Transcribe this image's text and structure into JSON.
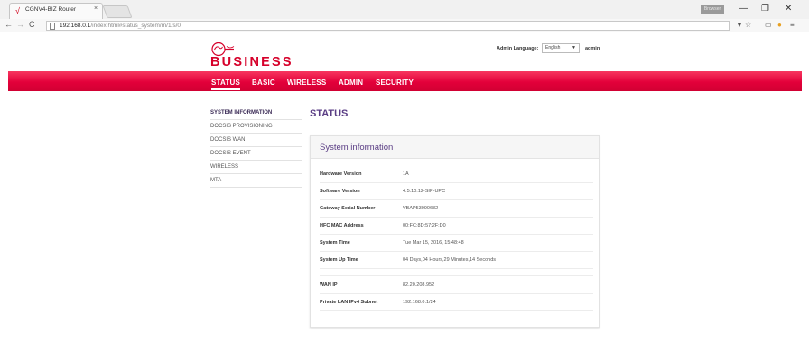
{
  "browser": {
    "tab_title": "CGNV4-BIZ Router",
    "tab_close": "×",
    "user_label": "Browser",
    "url_host": "192.168.0.1",
    "url_path": "/index.html#status_system/m/1/s/0",
    "minimize": "—",
    "restore": "❐",
    "close": "✕"
  },
  "header": {
    "brand": "BUSINESS",
    "language_label": "Admin Language:",
    "language_value": "English",
    "user": "admin"
  },
  "nav": {
    "items": [
      "STATUS",
      "BASIC",
      "WIRELESS",
      "ADMIN",
      "SECURITY"
    ]
  },
  "sidebar": {
    "items": [
      "SYSTEM INFORMATION",
      "DOCSIS PROVISIONING",
      "DOCSIS WAN",
      "DOCSIS EVENT",
      "WIRELESS",
      "MTA"
    ]
  },
  "main": {
    "title": "STATUS",
    "card_title": "System information",
    "rows": [
      {
        "label": "Hardware Version",
        "value": "1A"
      },
      {
        "label": "Software Version",
        "value": "4.5.10.12-SIP-UPC"
      },
      {
        "label": "Gateway Serial Number",
        "value": "VBAP53090682"
      },
      {
        "label": "HFC MAC Address",
        "value": "00:FC:8D:57:2F:D0"
      },
      {
        "label": "System Time",
        "value": "Tue Mar 15, 2016, 15:48:48"
      },
      {
        "label": "System Up Time",
        "value": "04 Days,04 Hours,29 Minutes,14 Seconds"
      },
      {
        "label": "WAN IP",
        "value": "82.20.208.952"
      },
      {
        "label": "Private LAN IPv4 Subnet",
        "value": "192.168.0.1/24"
      }
    ]
  },
  "colors": {
    "brand_red": "#d6002a",
    "nav_pink": "#e3003a",
    "accent_purple": "#5a3d84"
  }
}
